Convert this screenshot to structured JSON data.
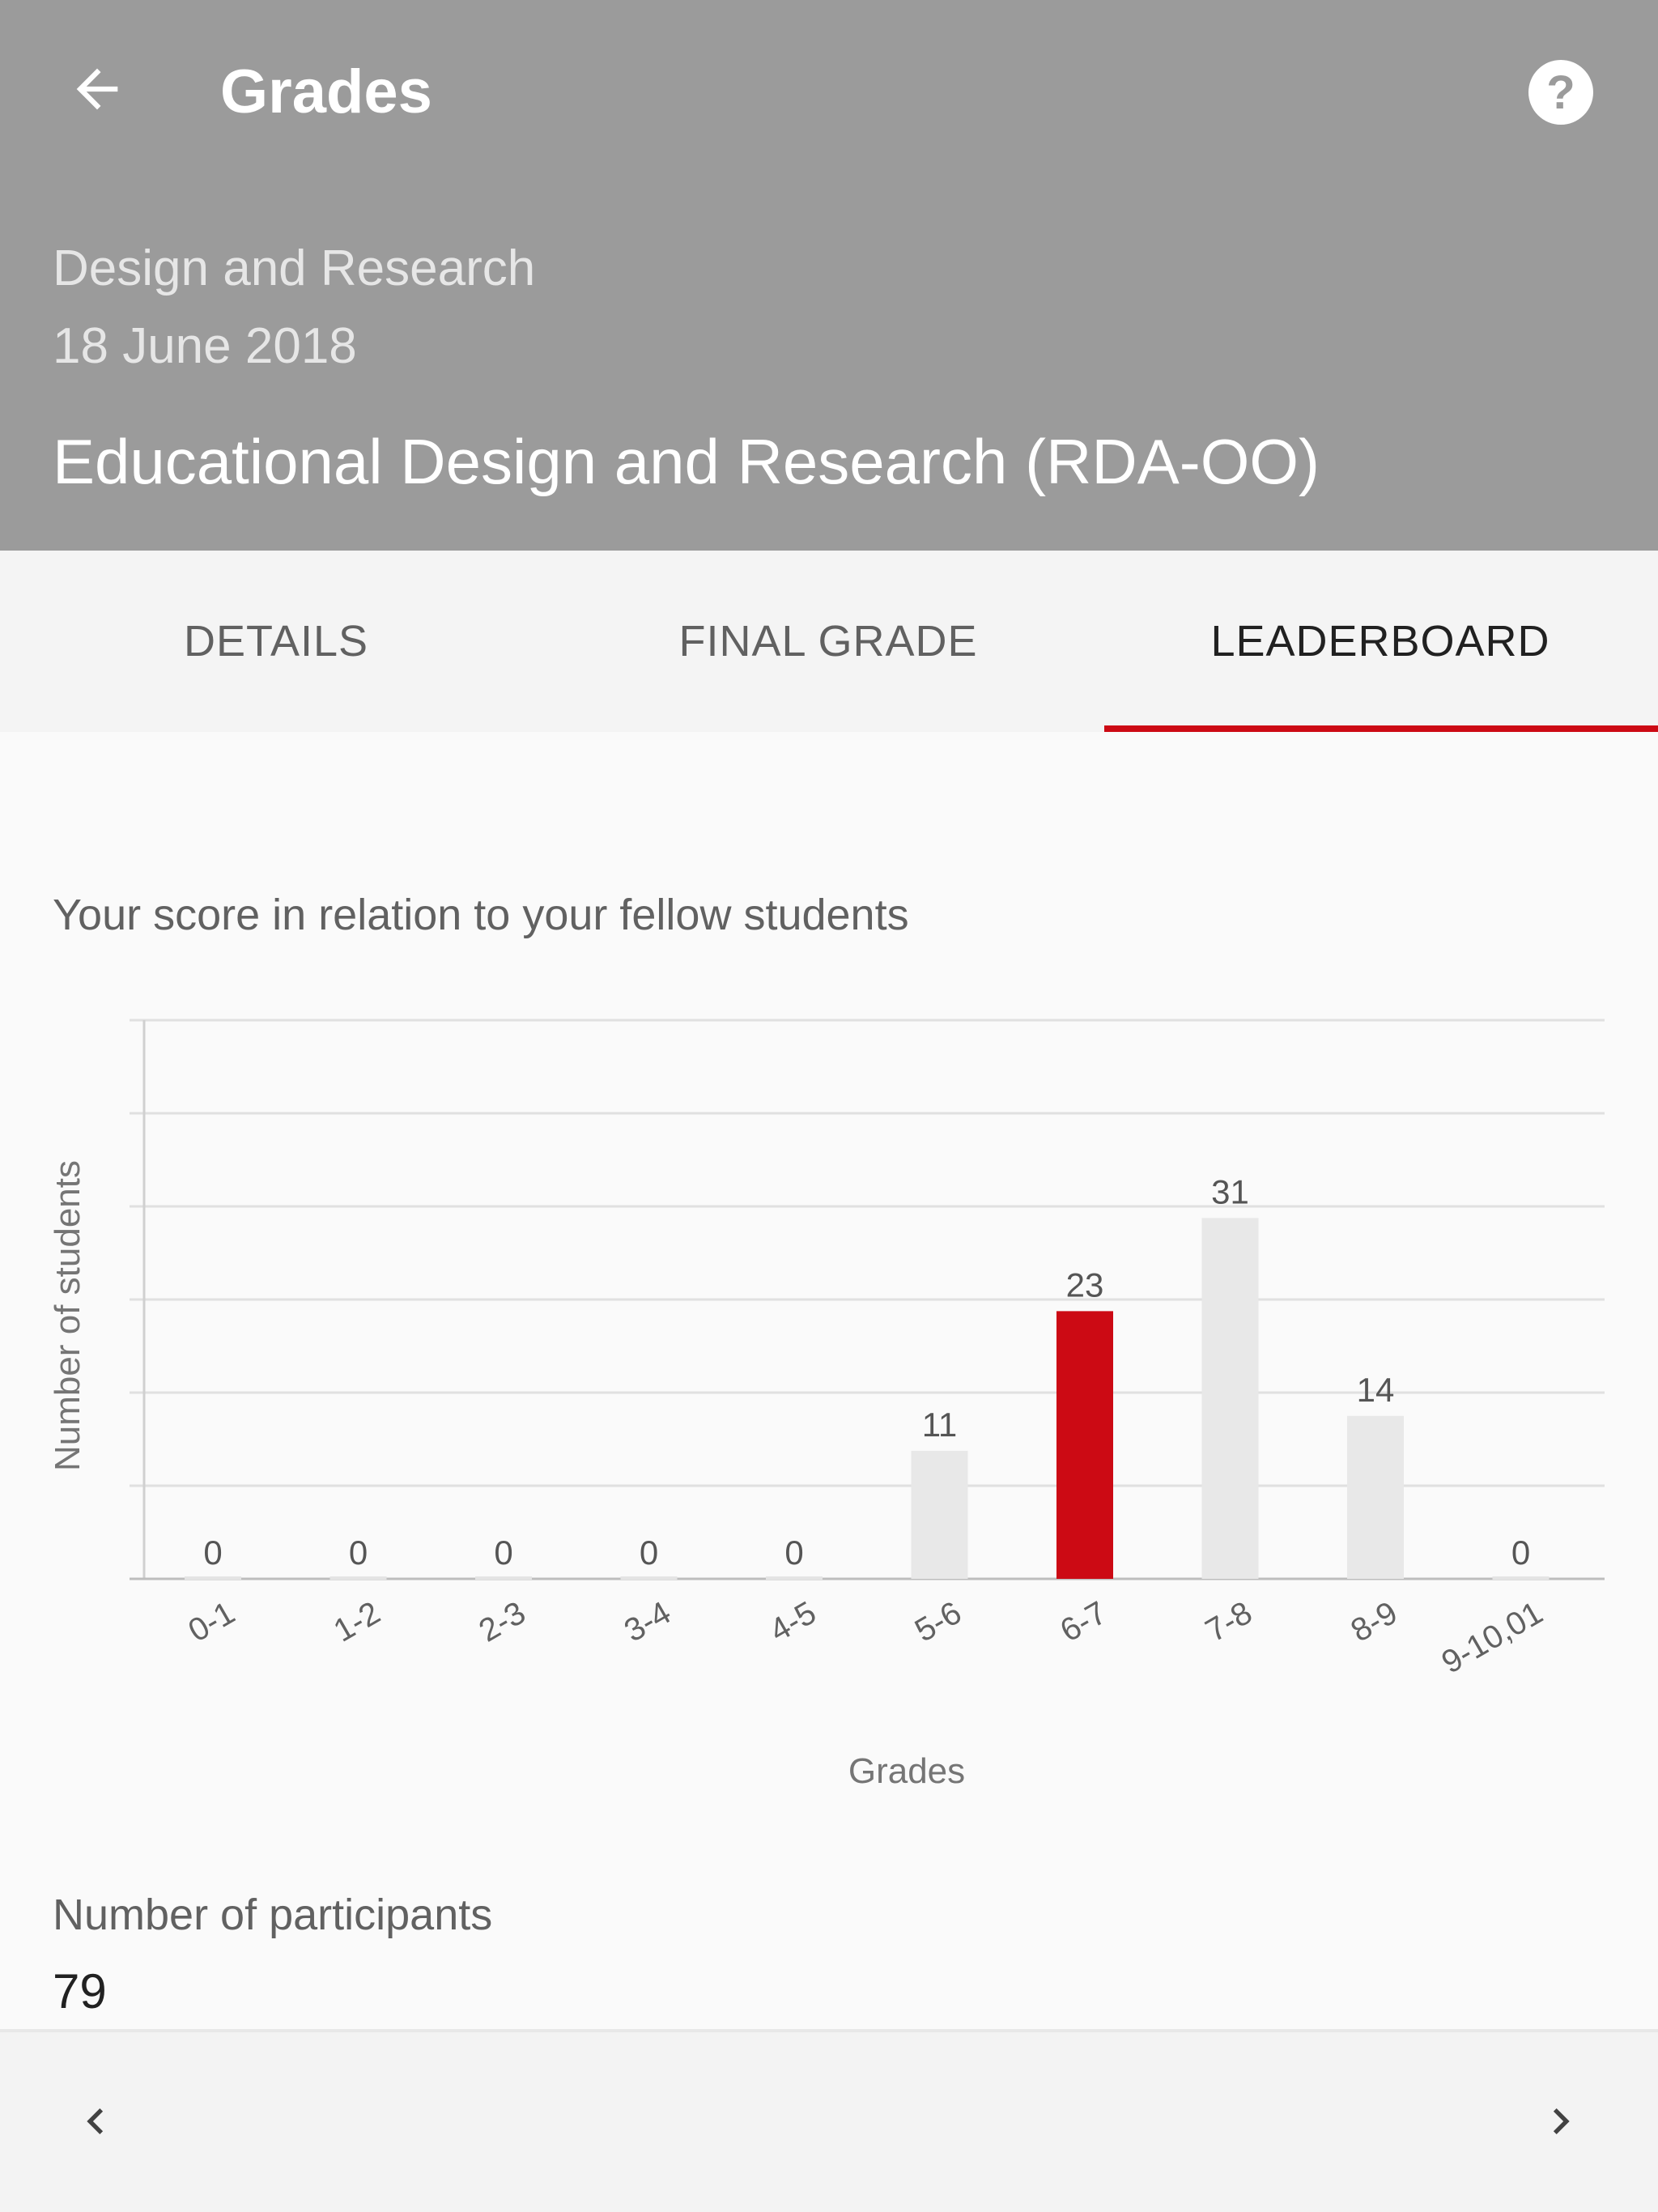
{
  "appbar": {
    "title": "Grades",
    "back_icon": "arrow-left-icon",
    "help_icon": "help-circle-icon",
    "bg_color": "#9b9b9b"
  },
  "course": {
    "category": "Design and Research",
    "date": "18 June 2018",
    "name": "Educational Design and Research (RDA-OO)"
  },
  "tabs": [
    {
      "label": "DETAILS",
      "active": false
    },
    {
      "label": "FINAL GRADE",
      "active": false
    },
    {
      "label": "LEADERBOARD",
      "active": true
    }
  ],
  "accent_color": "#cc0a14",
  "leaderboard": {
    "caption": "Your score in relation to your fellow students",
    "participants_label": "Number of participants",
    "participants_value": "79"
  },
  "chart_data": {
    "type": "bar",
    "title": "",
    "xlabel": "Grades",
    "ylabel": "Number of students",
    "categories": [
      "0-1",
      "1-2",
      "2-3",
      "3-4",
      "4-5",
      "5-6",
      "6-7",
      "7-8",
      "8-9",
      "9-10,01"
    ],
    "values": [
      0,
      0,
      0,
      0,
      0,
      11,
      23,
      31,
      14,
      0
    ],
    "highlight_index": 6,
    "highlight_color": "#cc0a14",
    "bar_color": "#e8e8e8",
    "ylim": [
      0,
      48
    ],
    "grid": true
  },
  "bottom_nav": {
    "prev_icon": "chevron-left-icon",
    "next_icon": "chevron-right-icon"
  }
}
